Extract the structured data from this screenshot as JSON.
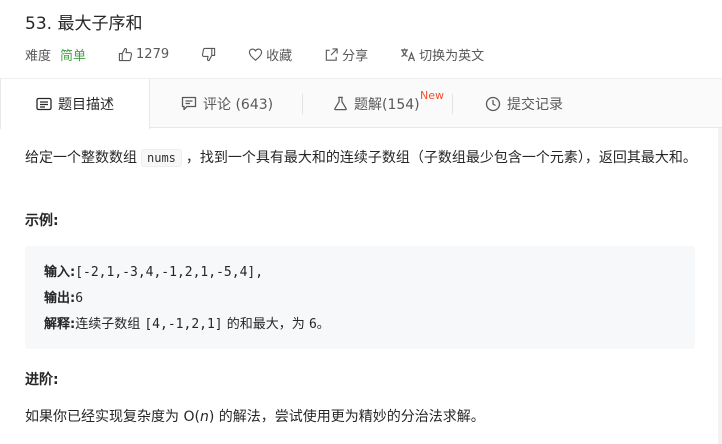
{
  "problem": {
    "title": "53. 最大子序和",
    "difficulty_label": "难度",
    "difficulty_value": "简单",
    "likes": "1279",
    "favorite_label": "收藏",
    "share_label": "分享",
    "switch_lang_label": "切换为英文"
  },
  "tabs": [
    {
      "label": "题目描述",
      "icon": "description-icon"
    },
    {
      "label": "评论 (643)",
      "icon": "comment-icon"
    },
    {
      "label": "题解(154)",
      "icon": "flask-icon",
      "badge": "New"
    },
    {
      "label": "提交记录",
      "icon": "clock-icon"
    }
  ],
  "colors": {
    "easy": "#43a047",
    "new_badge": "#f4512c",
    "tab_bg": "#fafafa"
  },
  "description": {
    "part1": "给定一个整数数组",
    "code_nums": "nums",
    "part2": "，找到一个具有最大和的连续子数组（子数组最少包含一个元素），返回其最大和。",
    "example_heading": "示例:",
    "example": {
      "input_label": "输入:",
      "input_value": "[-2,1,-3,4,-1,2,1,-5,4],",
      "output_label": "输出:",
      "output_value": "6",
      "explain_label": "解释:",
      "explain_pre": "连续子数组",
      "explain_code": "[4,-1,2,1]",
      "explain_mid": "的和最大，为",
      "explain_num": "6",
      "explain_end": "。"
    },
    "advanced_heading": "进阶:",
    "advanced_pre": "如果你已经实现复杂度为 O(",
    "advanced_n": "n",
    "advanced_post": ") 的解法，尝试使用更为精妙的分治法求解。"
  }
}
